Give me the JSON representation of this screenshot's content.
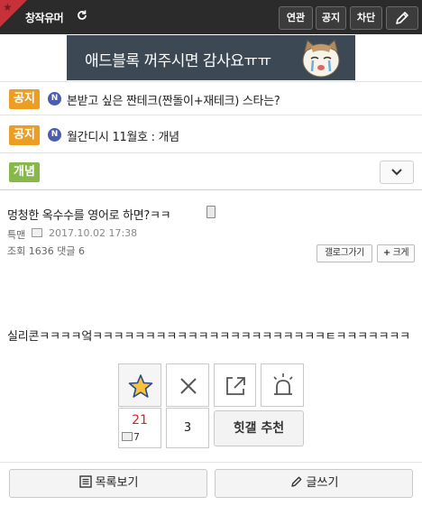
{
  "header": {
    "title": "창작유머",
    "buttons": {
      "related": "연관",
      "notice": "공지",
      "block": "차단"
    },
    "colors": {
      "bar": "#2b2b2b",
      "corner": "#c8313a"
    }
  },
  "ad": {
    "text": "애드블록 꺼주시면 감사요ㅠㅠ"
  },
  "notices": [
    {
      "tag": "공지",
      "badge": "N",
      "text": "본받고 싶은 짠테크(짠돌이+재테크) 스타는?"
    },
    {
      "tag": "공지",
      "badge": "N",
      "text": "월간디시 11월호 : 개념"
    }
  ],
  "concept_tag": "개념",
  "post": {
    "title": "멍청한 옥수수를 영어로 하면?ㅋㅋ",
    "author": "특맨",
    "date": "2017.10.02 17:38",
    "stats": "조회 1636 댓글 6",
    "gallery_button": "갤로그가기",
    "bigger_button": "크게",
    "content": "실리콘ㅋㅋㅋㅋ엌ㅋㅋㅋㅋㅋㅋㅋㅋㅋㅋㅋㅋㅋㅋㅋㅋㅋㅋㅋㅋㅋㅋㅌㅋㅋㅋㅋㅋㅋㅋ"
  },
  "recommend": {
    "up_count": "21",
    "fixed_count": "7",
    "down_count": "3",
    "hit_label": "힛갤 추천"
  },
  "bottom": {
    "list_label": "목록보기",
    "write_label": "글쓰기"
  }
}
